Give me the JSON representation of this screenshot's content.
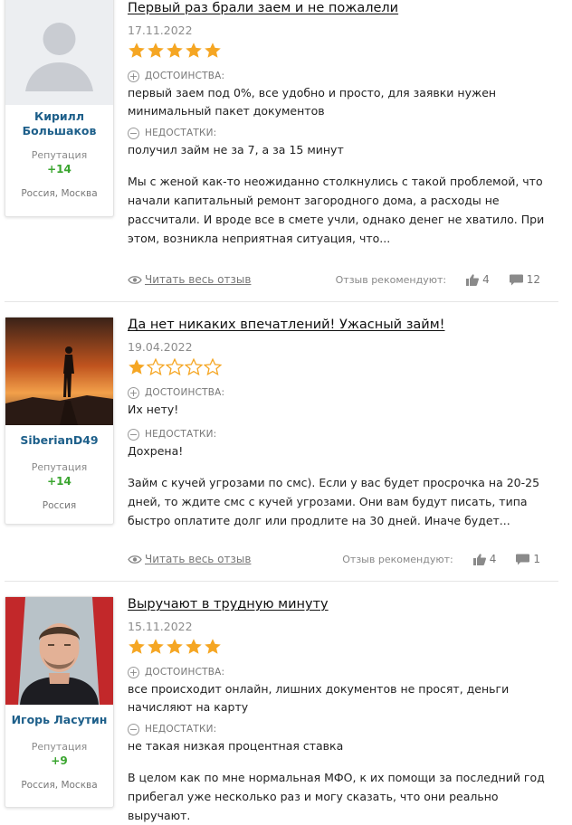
{
  "labels": {
    "pros": "ДОСТОИНСТВА:",
    "cons": "НЕДОСТАТКИ:",
    "reputation": "Репутация",
    "read_full": "Читать весь отзыв",
    "recommend": "Отзыв рекомендуют:"
  },
  "reviews": [
    {
      "user": "Кирилл Большаков",
      "reputation": "+14",
      "location": "Россия, Москва",
      "title": "Первый раз брали заем и не пожалели",
      "date": "17.11.2022",
      "rating": 5,
      "pros": "первый заем под 0%, все удобно и просто, для заявки нужен минимальный пакет документов",
      "cons": "получил займ не за 7, а за 15 минут",
      "body": "Мы с женой как-то неожиданно столкнулись с такой проблемой, что начали капитальный ремонт загородного дома, а расходы не рассчитали. И вроде все в смете учли, однако денег не хватило. При этом, возникла неприятная ситуация, что...",
      "likes": "4",
      "comments": "12"
    },
    {
      "user": "SiberianD49",
      "reputation": "+14",
      "location": "Россия",
      "title": "Да нет никаких впечатлений! Ужасный займ!",
      "date": "19.04.2022",
      "rating": 1,
      "pros": "Их нету!",
      "cons": "Дохрена!",
      "body": "Займ с кучей угрозами по смс). Если у вас будет просрочка на 20-25 дней, то ждите смс с кучей угрозами. Они вам будут писать, типа быстро оплатите долг или продлите на 30 дней. Иначе будет...",
      "likes": "4",
      "comments": "1"
    },
    {
      "user": "Игорь Ласутин",
      "reputation": "+9",
      "location": "Россия, Москва",
      "title": "Выручают в трудную минуту",
      "date": "15.11.2022",
      "rating": 5,
      "pros": "все происходит онлайн, лишних документов не просят, деньги начисляют на карту",
      "cons": "не такая низкая процентная ставка",
      "body": "В целом как по мне нормальная МФО, к их помощи за последний год прибегал уже несколько раз и могу сказать, что они реально выручают."
    }
  ],
  "colors": {
    "star": "#f5a623",
    "username": "#1d5f8a",
    "reputation": "#3aa52f"
  }
}
